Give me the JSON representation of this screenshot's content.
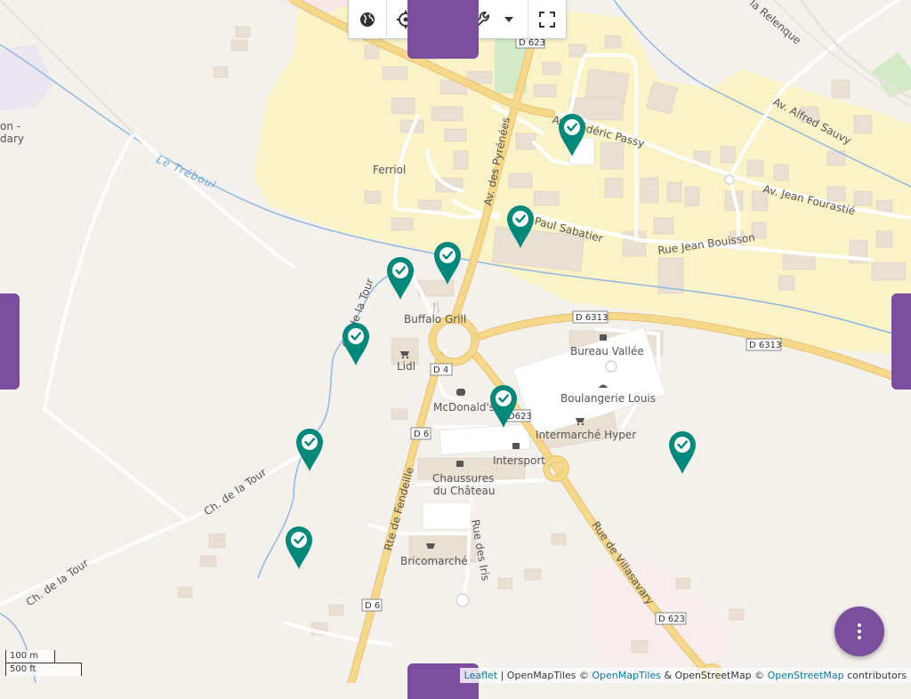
{
  "toolbar": {
    "buttons": [
      {
        "name": "globe-button",
        "icon": "globe-icon"
      },
      {
        "name": "locate-button",
        "icon": "crosshair-icon"
      },
      {
        "name": "place-marker-button",
        "icon": "map-pin-icon"
      },
      {
        "name": "tools-button",
        "icon": "wrench-icon"
      },
      {
        "name": "tools-dropdown-button",
        "icon": "caret-down-icon"
      },
      {
        "name": "fullscreen-button",
        "icon": "fullscreen-icon"
      }
    ]
  },
  "colors": {
    "marker": "#00897b",
    "tab": "#7b4f9e",
    "fab": "#7b4f9e",
    "road_major": "#f6d88a",
    "road_major_casing": "#e8c274",
    "residential_area": "#fbf3c8",
    "water": "#8fb8e5",
    "building": "#e9dfd3"
  },
  "map": {
    "road_labels": {
      "av_pyrenees": "Av. des Pyrénées",
      "av_frederic_passy": "Av. Frédéric Passy",
      "av_alfred_sauvy": "Av. Alfred Sauvy",
      "av_jean_fourastie": "Av. Jean Fourastié",
      "rue_paul_sabatier": "Paul Sabatier",
      "rue_jean_bouisson": "Rue Jean Bouisson",
      "la_relenque": "la Relenque",
      "ch_tour_1": "Ch. de la Tour",
      "ch_tour_2": "Ch. de la Tour",
      "ch_tour_3": "Ch. de la Tour",
      "rte_fendeille": "Rte de Fendeille",
      "rue_villasavary": "Rue de Villasavary",
      "rue_des_iris": "Rue des Iris"
    },
    "water_labels": {
      "le_treboul": "Le Tréboul"
    },
    "place_labels": {
      "ferriol": "Ferriol",
      "on_dary_1": "on -",
      "on_dary_2": "dary"
    },
    "road_shields": {
      "d623_top": "D 623",
      "d6313_a": "D 6313",
      "d6313_b": "D 6313",
      "d4": "D 4",
      "d6_a": "D 6",
      "d623_mid": "D623",
      "d6_b": "D 6",
      "d623_bottom": "D 623"
    },
    "pois": [
      {
        "name": "Buffalo Grill",
        "icon": "restaurant-icon"
      },
      {
        "name": "Lidl",
        "icon": "shop-cart-icon"
      },
      {
        "name": "Bureau Vallée",
        "icon": "shop-bag-icon"
      },
      {
        "name": "Boulangerie Louis",
        "icon": "bakery-icon"
      },
      {
        "name": "McDonald's",
        "icon": "fast-food-icon"
      },
      {
        "name": "Intermarché Hyper",
        "icon": "shop-cart-icon"
      },
      {
        "name": "Intersport",
        "icon": "shop-bag-icon"
      },
      {
        "name": "Chaussures",
        "name2": "du Château",
        "icon": "shop-bag-icon"
      },
      {
        "name": "Bricomarché",
        "icon": "shop-basket-icon"
      }
    ],
    "markers_count": 9
  },
  "fab": {
    "icon": "more-vertical-icon"
  },
  "scale": {
    "metric": "100 m",
    "imperial": "500 ft"
  },
  "attribution": {
    "leaflet": "Leaflet",
    "sep1": " | OpenMapTiles © ",
    "openmaptiles": "OpenMapTiles",
    "sep2": " & OpenStreetMap © ",
    "openstreetmap": "OpenStreetMap",
    "contributors": " contributors"
  }
}
